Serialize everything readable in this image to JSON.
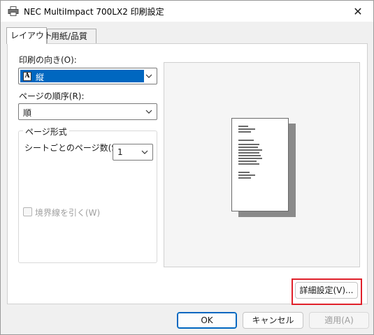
{
  "window": {
    "title": "NEC MultiImpact 700LX2 印刷設定",
    "close_glyph": "✕"
  },
  "tabs": [
    {
      "label": "レイアウト"
    },
    {
      "label": "用紙/品質"
    }
  ],
  "orientation": {
    "label": "印刷の向き(O):",
    "value": "縦",
    "icon_letter": "A"
  },
  "page_order": {
    "label": "ページの順序(R):",
    "value": "順"
  },
  "page_format": {
    "group_title": "ページ形式",
    "pages_per_sheet_label": "シートごとのページ数(S)",
    "pages_per_sheet_value": "1",
    "border_checkbox_label": "境界線を引く(W)",
    "border_checked": false
  },
  "buttons": {
    "advanced": "詳細設定(V)...",
    "ok": "OK",
    "cancel": "キャンセル",
    "apply": "適用(A)"
  },
  "colors": {
    "accent": "#0067c0",
    "highlight": "#e0202a"
  }
}
